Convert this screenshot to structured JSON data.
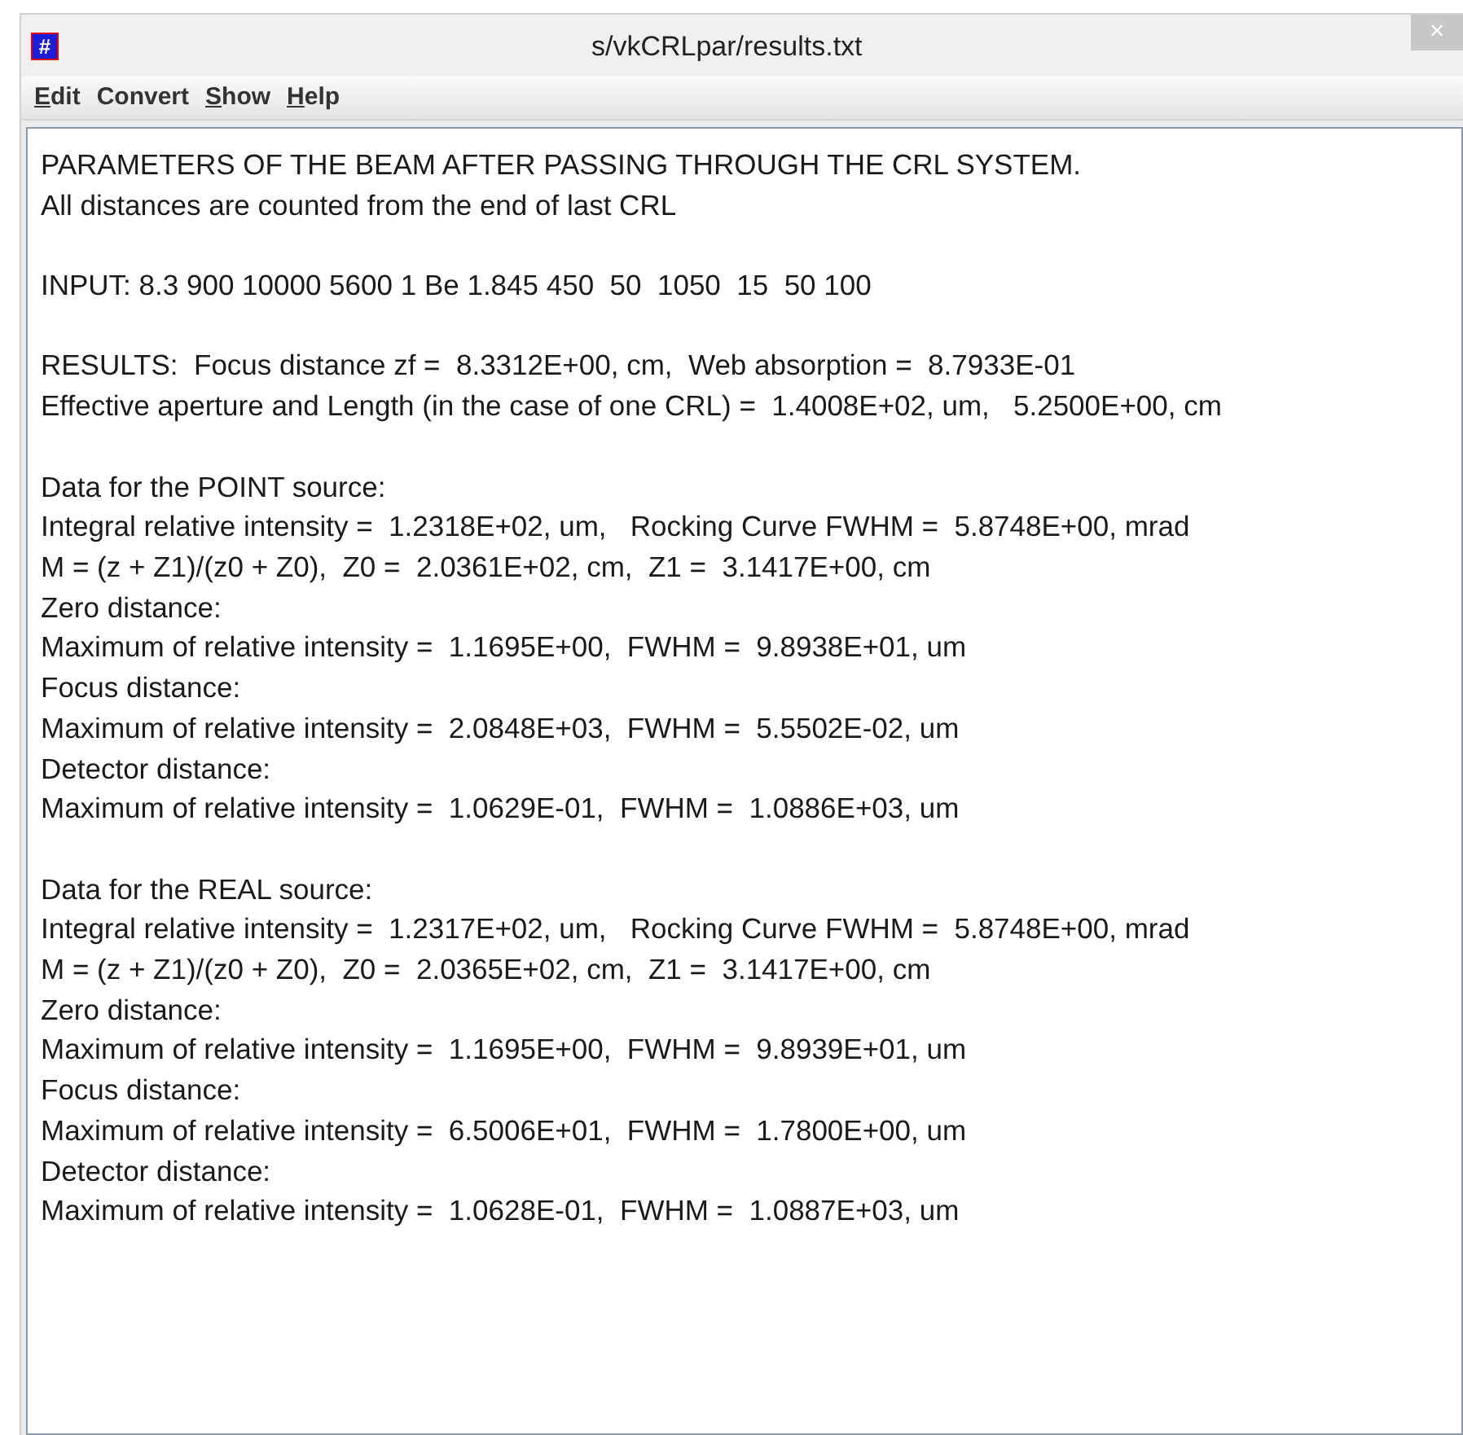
{
  "window": {
    "title": "s/vkCRLpar/results.txt",
    "icon_glyph": "#",
    "close_glyph": "×"
  },
  "menu": [
    {
      "mnemonic": "E",
      "rest": "dit"
    },
    {
      "rest": "Convert"
    },
    {
      "mnemonic": "S",
      "rest": "how"
    },
    {
      "mnemonic": "H",
      "rest": "elp"
    }
  ],
  "text_area": {
    "paragraphs": [
      [
        "PARAMETERS OF THE BEAM AFTER PASSING THROUGH THE CRL SYSTEM.",
        "All distances are counted from the end of last CRL"
      ],
      [
        "INPUT: 8.3 900 10000 5600 1 Be 1.845 450  50  1050  15  50 100"
      ],
      [
        "RESULTS:  Focus distance zf =  8.3312E+00, cm,  Web absorption =  8.7933E-01",
        "Effective aperture and Length (in the case of one CRL) =  1.4008E+02, um,   5.2500E+00, cm"
      ],
      [
        "Data for the POINT source:",
        "Integral relative intensity =  1.2318E+02, um,   Rocking Curve FWHM =  5.8748E+00, mrad",
        "M = (z + Z1)/(z0 + Z0),  Z0 =  2.0361E+02, cm,  Z1 =  3.1417E+00, cm",
        "Zero distance:",
        "Maximum of relative intensity =  1.1695E+00,  FWHM =  9.8938E+01, um",
        "Focus distance:",
        "Maximum of relative intensity =  2.0848E+03,  FWHM =  5.5502E-02, um",
        "Detector distance:",
        "Maximum of relative intensity =  1.0629E-01,  FWHM =  1.0886E+03, um"
      ],
      [
        "Data for the REAL source:",
        "Integral relative intensity =  1.2317E+02, um,   Rocking Curve FWHM =  5.8748E+00, mrad",
        "M = (z + Z1)/(z0 + Z0),  Z0 =  2.0365E+02, cm,  Z1 =  3.1417E+00, cm",
        "Zero distance:",
        "Maximum of relative intensity =  1.1695E+00,  FWHM =  9.8939E+01, um",
        "Focus distance:",
        "Maximum of relative intensity =  6.5006E+01,  FWHM =  1.7800E+00, um",
        "Detector distance:",
        "Maximum of relative intensity =  1.0628E-01,  FWHM =  1.0887E+03, um"
      ]
    ]
  }
}
